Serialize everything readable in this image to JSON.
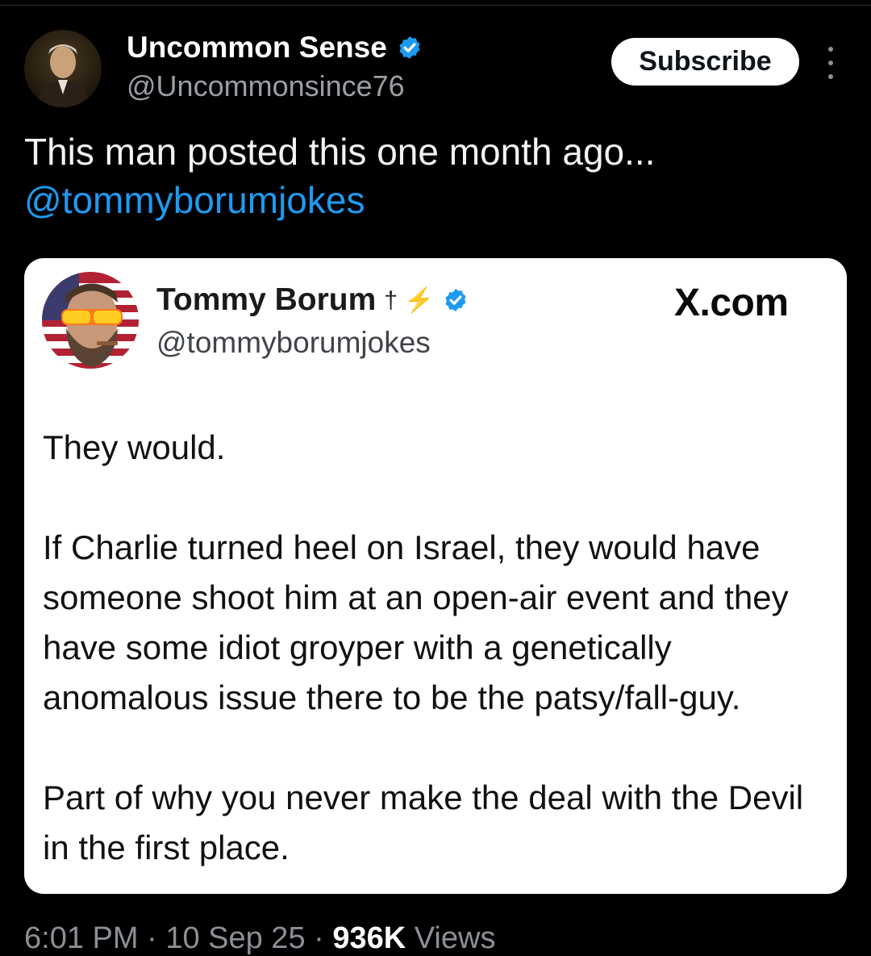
{
  "post": {
    "author": {
      "name": "Uncommon Sense",
      "handle": "@Uncommonsince76",
      "verified": true
    },
    "subscribe_label": "Subscribe",
    "text": "This man posted this one month ago...",
    "mention": "@tommyborumjokes",
    "meta": {
      "time": "6:01 PM",
      "separator": " · ",
      "date": "10 Sep 25",
      "views_count": "936K",
      "views_label": "Views"
    }
  },
  "embedded": {
    "author": {
      "name": "Tommy Borum",
      "name_emoji": "† ⚡",
      "handle": "@tommyborumjokes",
      "verified": true
    },
    "brand": "X.com",
    "paragraphs": [
      "They would.",
      "If Charlie turned heel on Israel, they would have someone shoot him at an open-air event and they have some idiot groyper with a genetically anomalous issue there to be the patsy/fall-guy.",
      "Part of why you never make the deal with the Devil in the first place."
    ]
  },
  "colors": {
    "background": "#000000",
    "link": "#1d9bf0",
    "verified": "#1d9bf0",
    "card": "#ffffff"
  },
  "icons": {
    "verified": "verified-badge-icon",
    "more": "more-vertical-icon"
  }
}
